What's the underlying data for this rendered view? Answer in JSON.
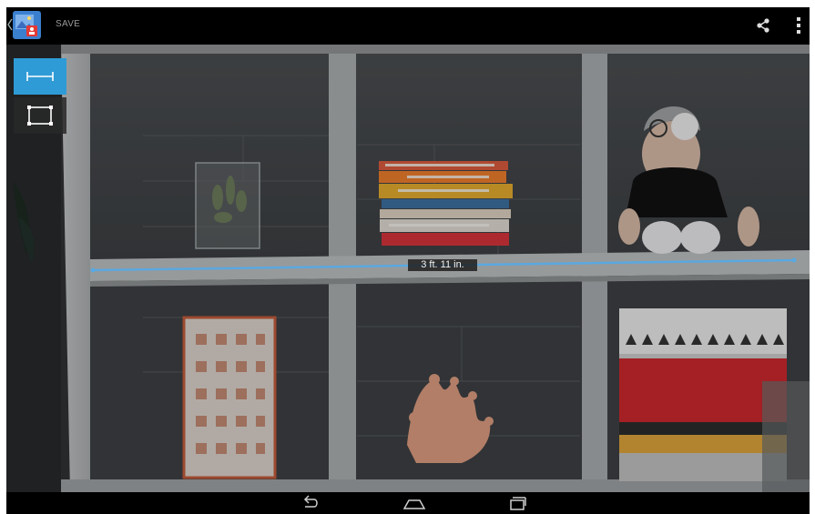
{
  "actionbar": {
    "save_label": "SAVE",
    "app_icon": "gallery-app-icon",
    "share_icon": "share-icon",
    "overflow_icon": "overflow-menu-icon",
    "back_icon": "back-chevron-icon"
  },
  "tools": {
    "measure_mode": {
      "icon": "linear-measure-icon",
      "selected": true
    },
    "area_mode": {
      "icon": "area-measure-icon",
      "selected": false
    }
  },
  "measurement": {
    "label": "3 ft. 11 in."
  },
  "navbar": {
    "back": "nav-back-icon",
    "home": "nav-home-icon",
    "recents": "nav-recents-icon"
  },
  "colors": {
    "accent": "#2f9bd6",
    "measure_line": "#5aa8e0",
    "action_text": "#9a9a9a"
  }
}
